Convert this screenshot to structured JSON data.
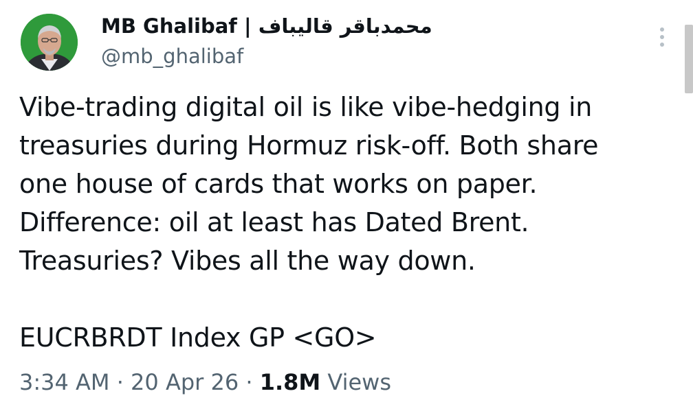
{
  "author": {
    "display_name": "MB Ghalibaf | محمدباقر قالیباف",
    "handle": "@mb_ghalibaf",
    "avatar_bg": "#2f9a3b"
  },
  "tweet": {
    "lines": [
      "Vibe-trading digital oil is like vibe-hedging in",
      "treasuries during Hormuz risk-off. Both share",
      "one house of cards that works on paper.",
      "Difference: oil at least has Dated Brent.",
      "Treasuries? Vibes all the way down."
    ],
    "command": "EUCRBRDT Index GP <GO>"
  },
  "meta": {
    "time": "3:34 AM",
    "separator": "·",
    "date": "20 Apr 26",
    "views_count": "1.8M",
    "views_label": "Views"
  },
  "icons": {
    "more": "more-vertical-icon"
  }
}
